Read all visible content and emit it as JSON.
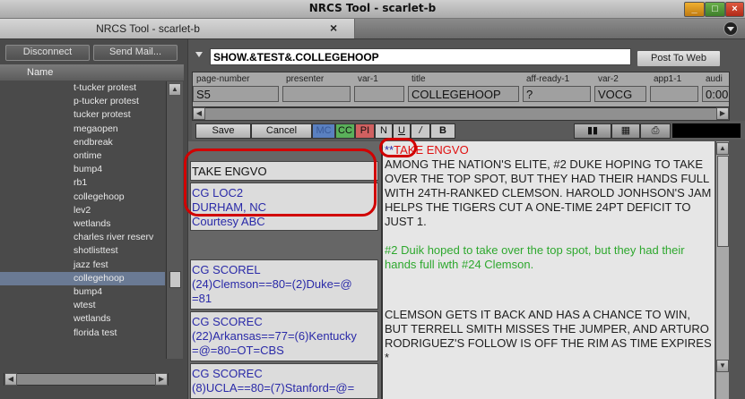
{
  "window": {
    "title": "NRCS Tool - scarlet-b"
  },
  "tab": {
    "label": "NRCS Tool - scarlet-b",
    "close": "×"
  },
  "left": {
    "disconnect": "Disconnect",
    "send_mail": "Send Mail...",
    "column_name": "Name",
    "items": [
      "t-tucker protest",
      "p-tucker protest",
      "tucker protest",
      "megaopen",
      "endbreak",
      "ontime",
      "bump4",
      "rb1",
      "collegehoop",
      "lev2",
      "wetlands",
      "charles river reserv",
      "shotlisttest",
      "jazz fest",
      "collegehoop",
      "bump4",
      "wtest",
      "wetlands",
      "florida test"
    ],
    "selected_index": 14
  },
  "slug": {
    "value": "SHOW.&TEST&.COLLEGEHOOP",
    "post": "Post To Web"
  },
  "fields": [
    {
      "header": "page-number",
      "value": "S5"
    },
    {
      "header": "presenter",
      "value": ""
    },
    {
      "header": "var-1",
      "value": ""
    },
    {
      "header": "title",
      "value": "COLLEGEHOOP"
    },
    {
      "header": "aff-ready-1",
      "value": "?"
    },
    {
      "header": "var-2",
      "value": "VOCG"
    },
    {
      "header": "app1-1",
      "value": ""
    },
    {
      "header": "audi",
      "value": "0:00"
    }
  ],
  "toolbar": {
    "save": "Save",
    "cancel": "Cancel",
    "mc": "MC",
    "cc": "CC",
    "pi": "PI",
    "n": "N",
    "u": "U",
    "i": "/",
    "b": "B"
  },
  "cues": [
    {
      "lines": [
        "TAKE ENGVO"
      ]
    },
    {
      "lines": [
        "CG LOC2",
        "DURHAM, NC",
        "Courtesy ABC"
      ]
    },
    {
      "lines": [
        "CG SCOREL",
        "(24)Clemson==80=(2)Duke=@",
        "=81"
      ]
    },
    {
      "lines": [
        "CG SCOREC",
        "(22)Arkansas==77=(6)Kentucky",
        "=@=80=OT=CBS"
      ]
    },
    {
      "lines": [
        "CG SCOREC",
        "(8)UCLA==80=(7)Stanford=@="
      ]
    }
  ],
  "story": {
    "marker": "**",
    "cue": "TAKE ENGVO",
    "p1": " AMONG THE NATION'S ELITE, #2 DUKE HOPING TO TAKE OVER THE TOP SPOT, BUT THEY HAD THEIR HANDS FULL WITH 24TH-RANKED CLEMSON.  HAROLD JONHSON'S JAM HELPS THE TIGERS CUT A ONE-TIME 24PT DEFICIT TO JUST 1.",
    "p2": "  #2 Duik hoped to take over the top spot, but they had their hands full iwth #24 Clemson.",
    "p3": "   CLEMSON GETS IT BACK AND HAS A CHANCE TO WIN, BUT TERRELL SMITH MISSES THE JUMPER, AND ARTURO RODRIGUEZ'S FOLLOW IS OFF THE RIM AS TIME EXPIRES *"
  },
  "colors": {
    "cue_text": "#2a2aa8",
    "story_cue": "#e01010",
    "note_green": "#2ea82e",
    "annotation": "#d10000",
    "selected_row": "#6a7a94"
  }
}
